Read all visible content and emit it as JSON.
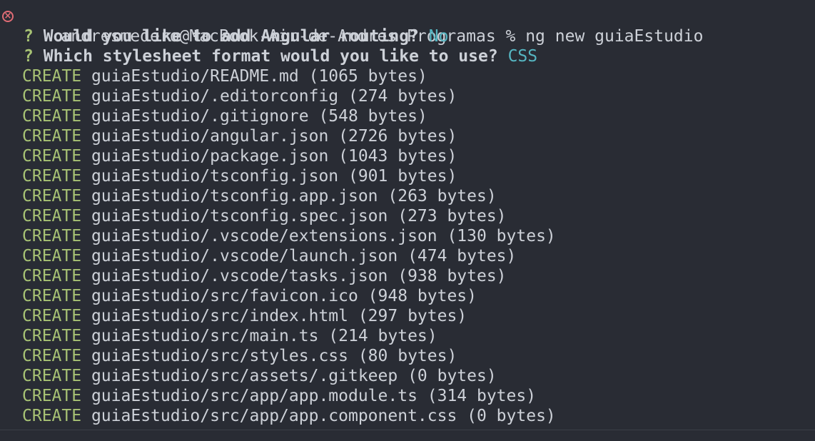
{
  "terminal": {
    "command_line": "andresmedero@MacBook-Air-de-Andres Programas % ng new guiaEstudio",
    "status_icon": "error-circle-icon",
    "questions": [
      {
        "mark": "?",
        "text": "Would you like to add Angular routing?",
        "answer": "No"
      },
      {
        "mark": "?",
        "text": "Which stylesheet format would you like to use?",
        "answer": "CSS"
      }
    ],
    "create_keyword": "CREATE",
    "files": [
      "guiaEstudio/README.md (1065 bytes)",
      "guiaEstudio/.editorconfig (274 bytes)",
      "guiaEstudio/.gitignore (548 bytes)",
      "guiaEstudio/angular.json (2726 bytes)",
      "guiaEstudio/package.json (1043 bytes)",
      "guiaEstudio/tsconfig.json (901 bytes)",
      "guiaEstudio/tsconfig.app.json (263 bytes)",
      "guiaEstudio/tsconfig.spec.json (273 bytes)",
      "guiaEstudio/.vscode/extensions.json (130 bytes)",
      "guiaEstudio/.vscode/launch.json (474 bytes)",
      "guiaEstudio/.vscode/tasks.json (938 bytes)",
      "guiaEstudio/src/favicon.ico (948 bytes)",
      "guiaEstudio/src/index.html (297 bytes)",
      "guiaEstudio/src/main.ts (214 bytes)",
      "guiaEstudio/src/styles.css (80 bytes)",
      "guiaEstudio/src/assets/.gitkeep (0 bytes)",
      "guiaEstudio/src/app/app.module.ts (314 bytes)",
      "guiaEstudio/src/app/app.component.css (0 bytes)"
    ]
  },
  "colors": {
    "background": "#292c34",
    "text": "#cdd1d8",
    "create_keyword": "#a7c274",
    "answer": "#56b6c2",
    "error": "#e06c75"
  }
}
